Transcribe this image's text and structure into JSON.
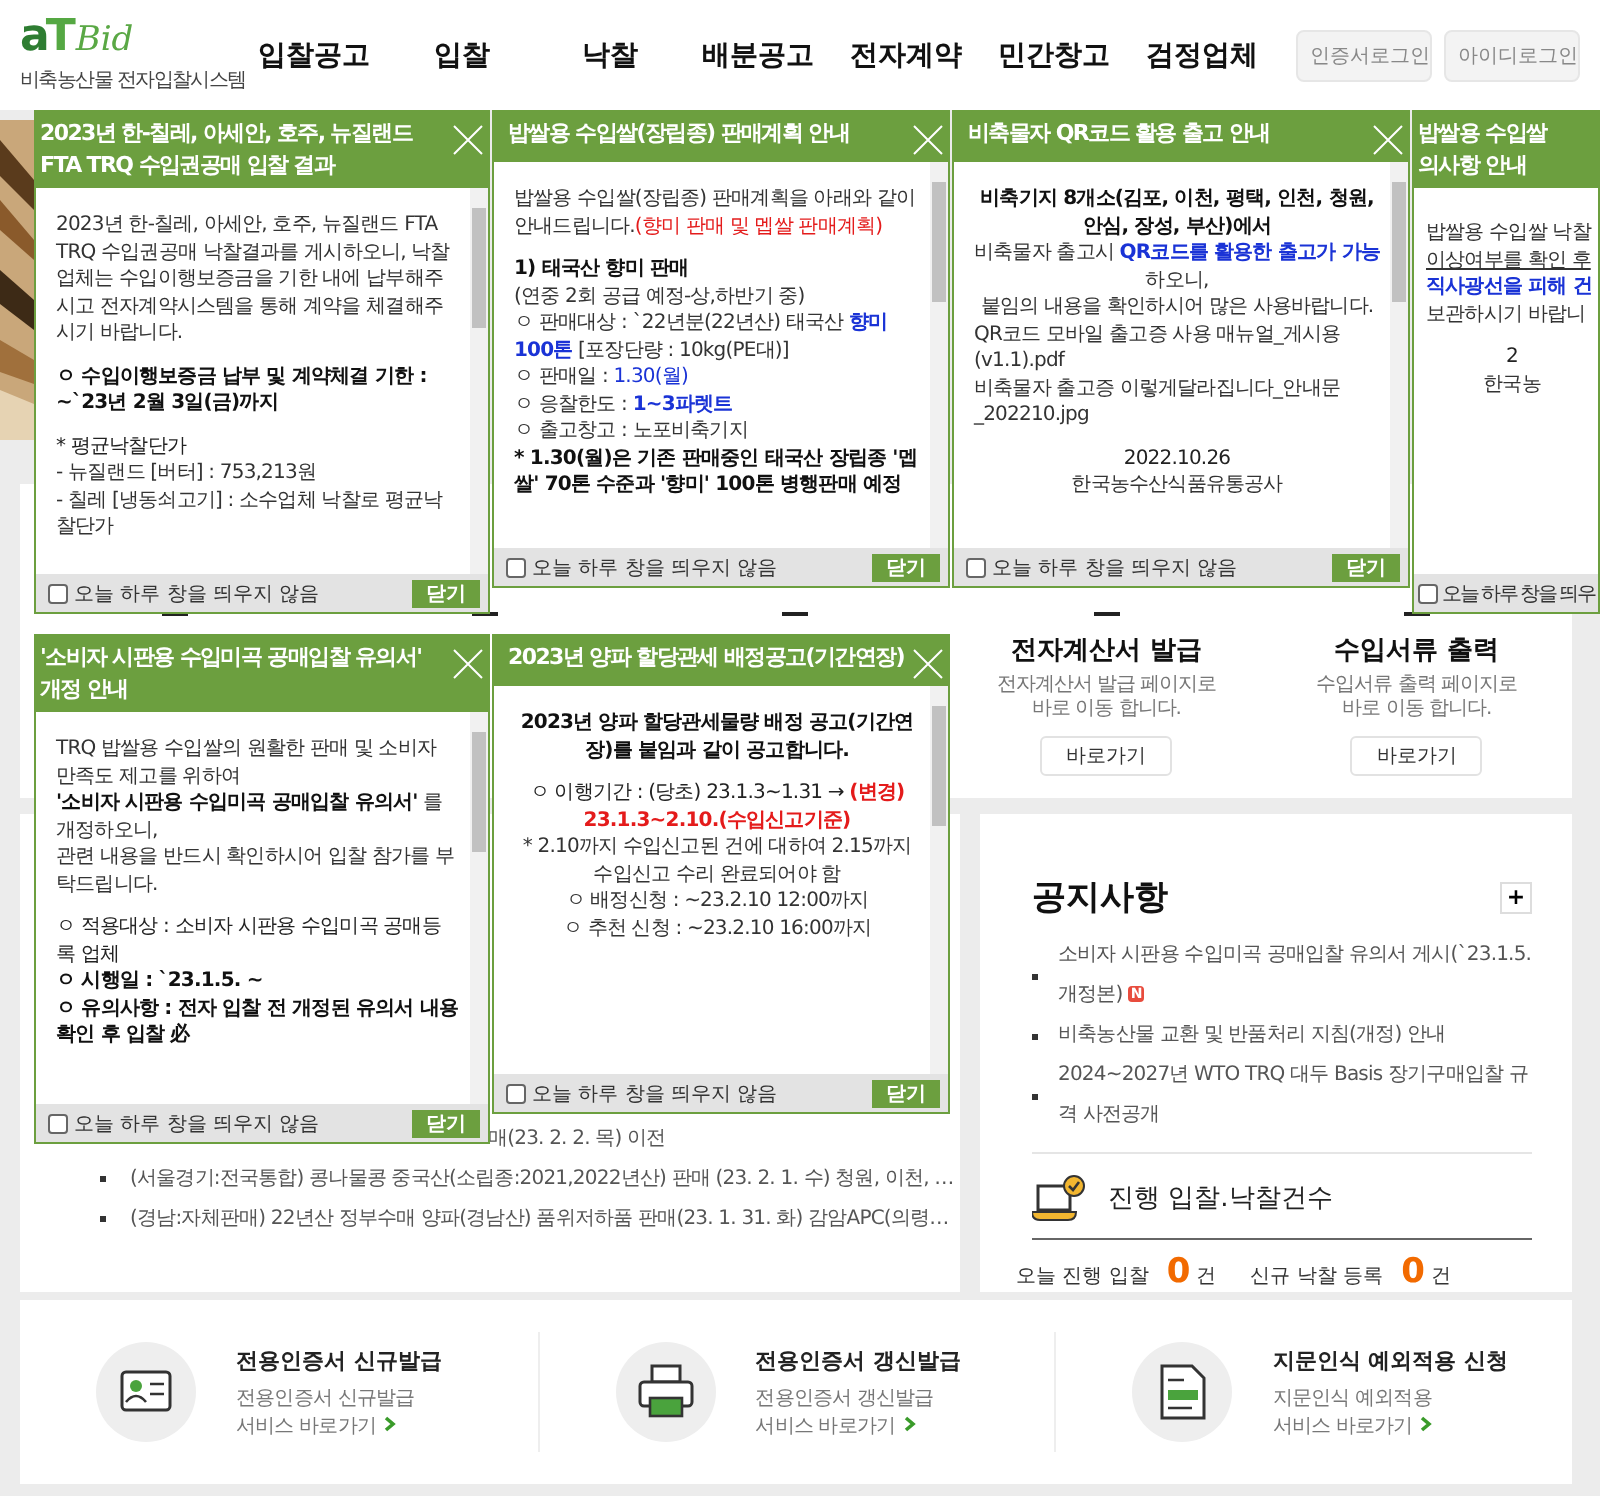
{
  "header": {
    "logo": {
      "mark": "aT",
      "wordmark": "Bid",
      "tagline": "비축농산물 전자입찰시스템"
    },
    "nav": [
      "입찰공고",
      "입찰",
      "낙찰",
      "배분공고",
      "전자계약",
      "민간창고",
      "검정업체"
    ],
    "buttons": [
      "인증서로그인",
      "아이디로그인"
    ]
  },
  "services": [
    {
      "title": "전자계산서 발급",
      "desc": [
        "전자계산서 발급 페이지로",
        "바로 이동 합니다."
      ],
      "button": "바로가기"
    },
    {
      "title": "수입서류 출력",
      "desc": [
        "수입서류 출력 페이지로",
        "바로 이동 합니다."
      ],
      "button": "바로가기"
    }
  ],
  "bid_list": [
    {
      "kind": "fragment",
      "text": "매(23. 2. 2. 목) 이전"
    },
    {
      "kind": "item",
      "text": "(서울경기:전국통합) 콩나물콩 중국산(소립종:2021,2022년산) 판매 (23. 2. 1. 수) 청원, 이천, …"
    },
    {
      "kind": "item",
      "text": "(경남:자체판매) 22년산 정부수매 양파(경남산) 품위저하품 판매(23. 1. 31. 화) 감암APC(의령…"
    }
  ],
  "notices": {
    "title": "공지사항",
    "more": "+",
    "items": [
      {
        "text": "소비자 시판용 수입미곡 공매입찰 유의서 게시(`23.1.5. 개정본)",
        "badge": "N"
      },
      {
        "text": "비축농산물 교환 및 반품처리 지침(개정) 안내"
      },
      {
        "text": "2024~2027년 WTO TRQ 대두 Basis 장기구매입찰 규격 사전공개"
      }
    ],
    "counts_title": "진행 입찰.낙찰건수",
    "counts": [
      {
        "label": "오늘 진행 입찰",
        "value": "0",
        "unit": "건"
      },
      {
        "label": "신규 낙찰 등록",
        "value": "0",
        "unit": "건"
      }
    ]
  },
  "quick_links": [
    {
      "title": "전용인증서 신규발급",
      "desc": "전용인증서 신규발급",
      "link": "서비스 바로가기"
    },
    {
      "title": "전용인증서 갱신발급",
      "desc": "전용인증서 갱신발급",
      "link": "서비스 바로가기"
    },
    {
      "title": "지문인식 예외적용 신청",
      "desc": "지문인식 예외적용",
      "link": "서비스 바로가기"
    }
  ],
  "popups": [
    {
      "title": [
        "2023년 한-칠레, 아세안, 호주, 뉴질랜드",
        "FTA TRQ 수입권공매 입찰 결과"
      ],
      "cut_off": false,
      "body": [
        {
          "centered": false,
          "spaced": false,
          "lines": [
            [
              {
                "t": "2023년 한-칠레, 아세안, 호주, 뉴질랜드 FTA TRQ 수입권공매 낙찰결과를 게시하오니, 낙찰업체는 수입이행보증금을 기한 내에 납부해주시고 전자계약시스템을 통해 계약을 체결해주시기 바랍니다.",
                "kind": "plain"
              }
            ]
          ]
        },
        {
          "centered": false,
          "spaced": true,
          "lines": [
            [
              {
                "t": "ㅇ 수입이행보증금 납부 및 계약체결 기한 : ~`23년 2월 3일(금)까지",
                "kind": "strong"
              }
            ]
          ]
        },
        {
          "centered": false,
          "spaced": true,
          "lines": [
            [
              {
                "t": "* 평균낙찰단가",
                "kind": "plain"
              }
            ],
            [
              {
                "t": " - 뉴질랜드 [버터] : 753,213원",
                "kind": "plain"
              }
            ],
            [
              {
                "t": " - 칠레 [냉동쇠고기] : 소수업체 낙찰로 평균낙찰단가",
                "kind": "plain"
              }
            ]
          ]
        }
      ],
      "footer": {
        "label": "오늘 하루 창을 띄우지 않음",
        "checked": false,
        "close": "닫기"
      }
    },
    {
      "title": [
        "밥쌀용 수입쌀(장립종) 판매계획 안내"
      ],
      "cut_off": false,
      "body": [
        {
          "centered": false,
          "spaced": false,
          "lines": [
            [
              {
                "t": "밥쌀용 수입쌀(장립종) 판매계획을 아래와 같이 안내드립니다.",
                "kind": "plain"
              },
              {
                "t": "(향미 판매 및 멥쌀 판매계획)",
                "kind": "warning"
              }
            ]
          ]
        },
        {
          "centered": false,
          "spaced": true,
          "lines": [
            [
              {
                "t": "1) 태국산 향미 판매",
                "kind": "strong"
              }
            ],
            [
              {
                "t": "(연중 2회 공급 예정-상,하반기 중)",
                "kind": "plain"
              }
            ],
            [
              {
                "t": " ㅇ 판매대상 : `22년분(22년산) 태국산 ",
                "kind": "plain"
              },
              {
                "t": "향미 100톤",
                "kind": "keyword"
              },
              {
                "t": " [포장단량 : 10kg(PE대)]",
                "kind": "plain"
              }
            ],
            [
              {
                "t": " ㅇ 판매일 : ",
                "kind": "plain"
              },
              {
                "t": "1.30(월)",
                "kind": "highlight"
              }
            ],
            [
              {
                "t": " ㅇ 응찰한도 : ",
                "kind": "plain"
              },
              {
                "t": "1~3파렛트",
                "kind": "keyword"
              }
            ],
            [
              {
                "t": " ㅇ 출고창고 : 노포비축기지",
                "kind": "plain"
              }
            ],
            [
              {
                "t": " * 1.30(월)은 기존 판매중인 태국산 장립종 '멥쌀' 70톤 수준과 '향미' 100톤 병행판매 예정",
                "kind": "strong"
              }
            ]
          ]
        }
      ],
      "footer": {
        "label": "오늘 하루 창을 띄우지 않음",
        "checked": false,
        "close": "닫기"
      }
    },
    {
      "title": [
        "비축물자 QR코드 활용 출고 안내"
      ],
      "cut_off": false,
      "body": [
        {
          "centered": true,
          "spaced": false,
          "lines": [
            [
              {
                "t": "비축기지 8개소(김포, 이천, 평택, 인천, 청원, 안심, 장성, 부산)에서",
                "kind": "strong"
              }
            ],
            [
              {
                "t": "비축물자 출고시 ",
                "kind": "plain"
              },
              {
                "t": "QR코드를 활용한 출고가 가능",
                "kind": "keyword"
              },
              {
                "t": " 하오니,",
                "kind": "plain"
              }
            ],
            [
              {
                "t": "붙임의 내용을 확인하시어 많은 사용바랍니다.",
                "kind": "plain"
              }
            ]
          ]
        },
        {
          "centered": false,
          "spaced": false,
          "lines": [
            [
              {
                "t": "QR코드 모바일 출고증 사용 매뉴얼_게시용(v1.1).pdf",
                "kind": "plain"
              }
            ],
            [
              {
                "t": "비축물자 출고증 이렇게달라집니다_안내문_202210.jpg",
                "kind": "plain"
              }
            ]
          ]
        },
        {
          "centered": true,
          "spaced": true,
          "lines": [
            [
              {
                "t": "2022.10.26",
                "kind": "plain"
              }
            ],
            [
              {
                "t": "한국농수산식품유통공사",
                "kind": "plain"
              }
            ]
          ]
        }
      ],
      "footer": {
        "label": "오늘 하루 창을 띄우지 않음",
        "checked": false,
        "close": "닫기"
      }
    },
    {
      "title": [
        "밥쌀용 수입쌀",
        "의사항 안내"
      ],
      "cut_off": true,
      "body": [
        {
          "centered": false,
          "spaced": false,
          "lines": [
            [
              {
                "t": "밥쌀용 수입쌀 낙찰",
                "kind": "plain"
              }
            ],
            [
              {
                "t": "이상여부를 확인 후",
                "kind": "underlined"
              }
            ],
            [
              {
                "t": "직사광선을 피해 건",
                "kind": "keyword"
              }
            ],
            [
              {
                "t": "보관하시기 바랍니",
                "kind": "plain"
              }
            ]
          ]
        },
        {
          "centered": true,
          "spaced": true,
          "lines": [
            [
              {
                "t": "2",
                "kind": "plain"
              }
            ],
            [
              {
                "t": "한국농",
                "kind": "plain"
              }
            ]
          ]
        }
      ],
      "footer": {
        "label": "오늘 하루 창을 띄우",
        "checked": false
      }
    },
    {
      "title": [
        "'소비자 시판용 수입미곡 공매입찰 유의서'",
        "개정 안내"
      ],
      "cut_off": false,
      "body": [
        {
          "centered": false,
          "spaced": false,
          "lines": [
            [
              {
                "t": "TRQ 밥쌀용 수입쌀의 원활한 판매 및 소비자 만족도 제고를 위하여",
                "kind": "plain"
              }
            ],
            [
              {
                "t": "'소비자 시판용 수입미곡 공매입찰 유의서'",
                "kind": "strong"
              },
              {
                "t": " 를 개정하오니,",
                "kind": "plain"
              }
            ],
            [
              {
                "t": "관련 내용을 반드시 확인하시어 입찰 참가를 부탁드립니다.",
                "kind": "plain"
              }
            ]
          ]
        },
        {
          "centered": false,
          "spaced": true,
          "lines": [
            [
              {
                "t": "ㅇ 적용대상 : 소비자 시판용 수입미곡 공매등록 업체",
                "kind": "plain"
              }
            ],
            [
              {
                "t": "ㅇ 시행일 : `23.1.5. ~",
                "kind": "strong"
              }
            ],
            [
              {
                "t": "ㅇ 유의사항 : 전자 입찰 전 개정된 유의서 내용 확인 후 입찰 必",
                "kind": "strong"
              }
            ]
          ]
        }
      ],
      "footer": {
        "label": "오늘 하루 창을 띄우지 않음",
        "checked": false,
        "close": "닫기"
      }
    },
    {
      "title": [
        "2023년 양파 할당관세 배정공고(기간연장)"
      ],
      "cut_off": false,
      "body": [
        {
          "centered": true,
          "spaced": false,
          "lines": [
            [
              {
                "t": "2023년 양파 할당관세물량 배정 공고(기간연장)를 붙임과 같이 공고합니다.",
                "kind": "strong"
              }
            ]
          ]
        },
        {
          "centered": true,
          "spaced": true,
          "lines": [
            [
              {
                "t": "ㅇ 이행기간 : (당초) 23.1.3~1.31 → ",
                "kind": "plain"
              },
              {
                "t": "(변경) 23.1.3~2.10.(수입신고기준)",
                "kind": "alert"
              }
            ],
            [
              {
                "t": "* 2.10까지 수입신고된 건에 대하여 2.15까지 수입신고 수리 완료되어야 함",
                "kind": "plain"
              }
            ],
            [
              {
                "t": "ㅇ 배정신청 : ~23.2.10 12:00까지",
                "kind": "plain"
              }
            ],
            [
              {
                "t": "ㅇ 추천 신청 : ~23.2.10 16:00까지",
                "kind": "plain"
              }
            ]
          ]
        }
      ],
      "footer": {
        "label": "오늘 하루 창을 띄우지 않음",
        "checked": false,
        "close": "닫기"
      }
    }
  ]
}
